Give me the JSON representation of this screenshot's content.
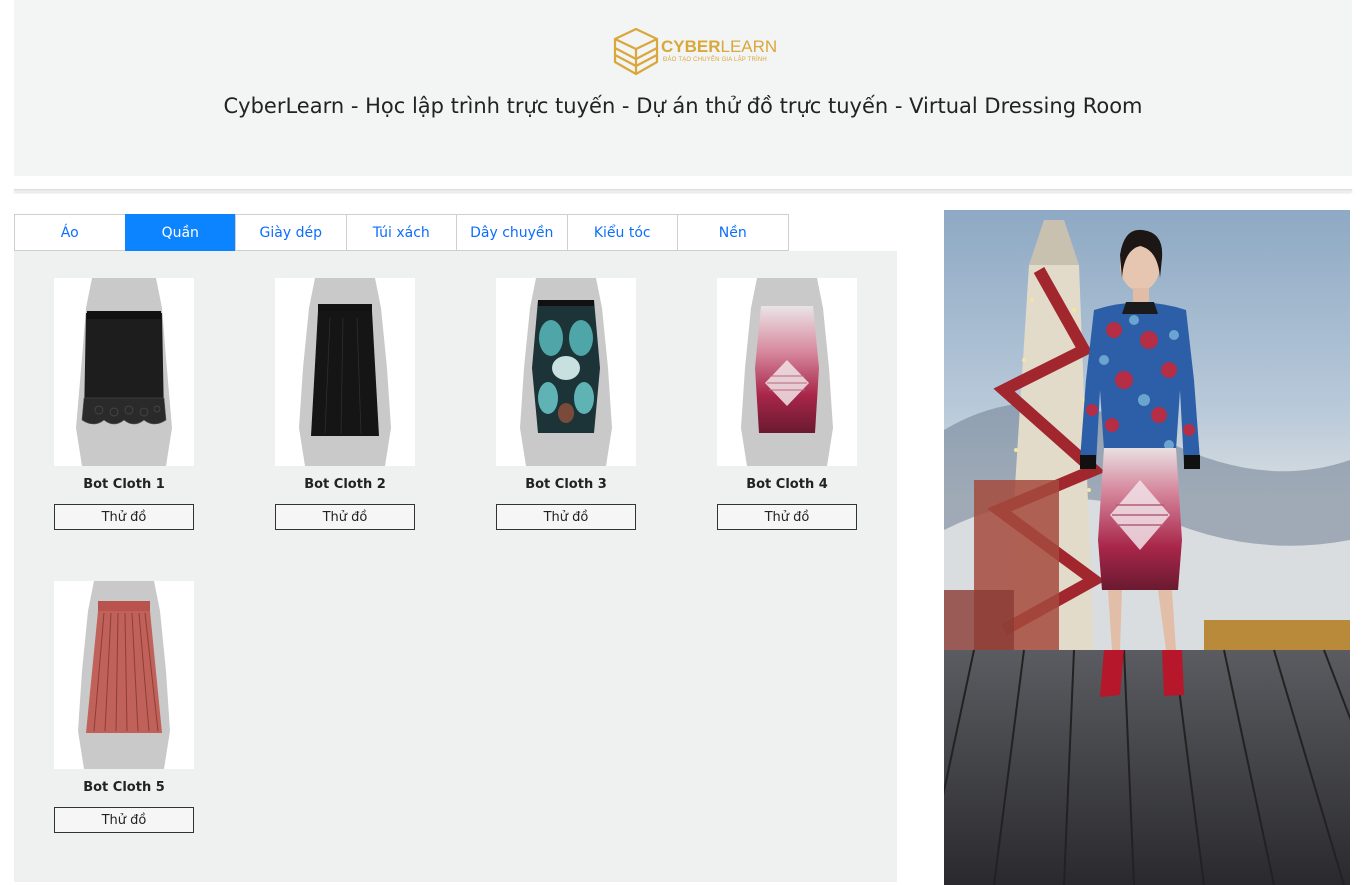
{
  "header": {
    "logo": {
      "brand_main": "CYBER",
      "brand_accent": "LEARN",
      "tagline": "ĐÀO TẠO CHUYÊN GIA LẬP TRÌNH",
      "color": "#d9a73a"
    },
    "title": "CyberLearn - Học lập trình trực tuyến - Dự án thử đồ trực tuyến - Virtual Dressing Room"
  },
  "tabs": [
    {
      "label": "Áo",
      "active": false
    },
    {
      "label": "Quần",
      "active": true
    },
    {
      "label": "Giày dép",
      "active": false
    },
    {
      "label": "Túi xách",
      "active": false
    },
    {
      "label": "Dây chuyền",
      "active": false
    },
    {
      "label": "Kiểu tóc",
      "active": false
    },
    {
      "label": "Nền",
      "active": false
    }
  ],
  "products": [
    {
      "name": "Bot Cloth 1",
      "button": "Thử đồ",
      "style": "black-lace-skirt"
    },
    {
      "name": "Bot Cloth 2",
      "button": "Thử đồ",
      "style": "black-maxi-skirt"
    },
    {
      "name": "Bot Cloth 3",
      "button": "Thử đồ",
      "style": "printed-pencil-skirt"
    },
    {
      "name": "Bot Cloth 4",
      "button": "Thử đồ",
      "style": "pink-gradient-skirt"
    },
    {
      "name": "Bot Cloth 5",
      "button": "Thử đồ",
      "style": "red-pleated-skirt"
    }
  ],
  "colors": {
    "accent": "#0d84ff",
    "link": "#0d6efd",
    "panel": "#eff0f0"
  }
}
